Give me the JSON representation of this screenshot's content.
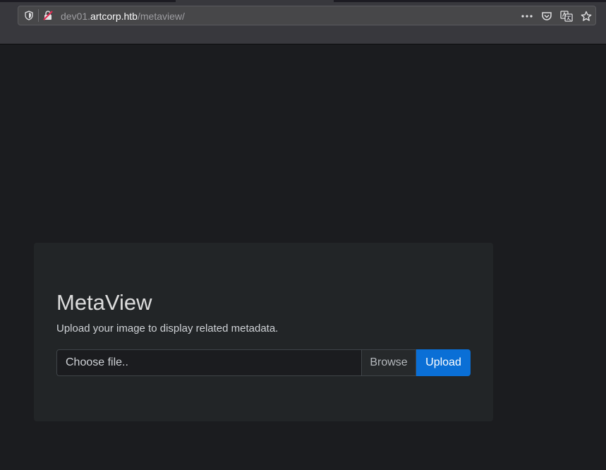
{
  "browser": {
    "url_prefix": "dev01.",
    "url_domain": "artcorp.htb",
    "url_path": "/metaview/",
    "icons": [
      "shield-icon",
      "insecure-lock-icon",
      "more-dots-icon",
      "pocket-icon",
      "translate-icon",
      "bookmark-star-icon"
    ]
  },
  "card": {
    "title": "MetaView",
    "lead": "Upload your image to display related metadata.",
    "file_placeholder": "Choose file..",
    "browse_label": "Browse",
    "upload_label": "Upload"
  },
  "colors": {
    "page_bg": "#1b1c1f",
    "card_bg": "#222527",
    "accent": "#0a6fd6"
  }
}
